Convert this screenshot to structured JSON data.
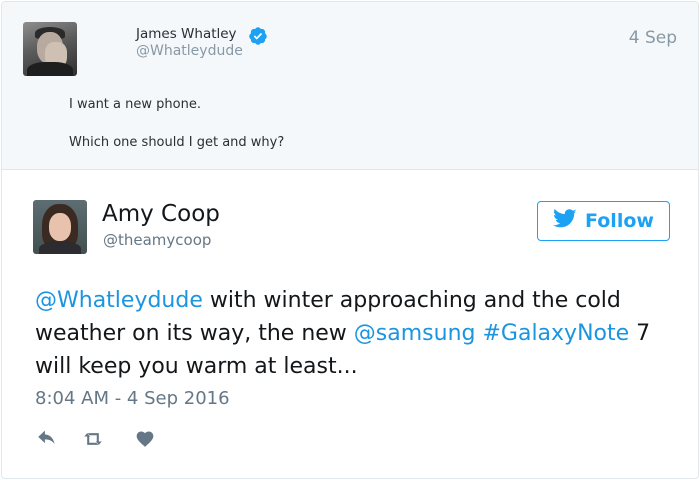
{
  "parent_tweet": {
    "author_name": "James Whatley",
    "author_handle": "@Whatleydude",
    "date": "4 Sep",
    "lines": [
      "I want a new phone.",
      "Which one should I get and why?"
    ]
  },
  "tweet": {
    "author_name": "Amy Coop",
    "author_handle": "@theamycoop",
    "follow_label": "Follow",
    "text_parts": {
      "mention_whatley": "@Whatleydude",
      "part1": " with winter approaching and the cold weather on its way, the new ",
      "mention_samsung": "@samsung",
      "part2": " ",
      "hashtag": "#GalaxyNote",
      "part3": " 7 will keep you warm at least..."
    },
    "timestamp": "8:04 AM - 4 Sep 2016"
  },
  "colors": {
    "link": "#1b95e0",
    "twitter_blue": "#1da1f2",
    "muted": "#657786",
    "quoted_background": "#f5f8fa"
  },
  "icons": [
    "verified-badge-icon",
    "twitter-bird-icon",
    "reply-icon",
    "retweet-icon",
    "like-heart-icon"
  ]
}
